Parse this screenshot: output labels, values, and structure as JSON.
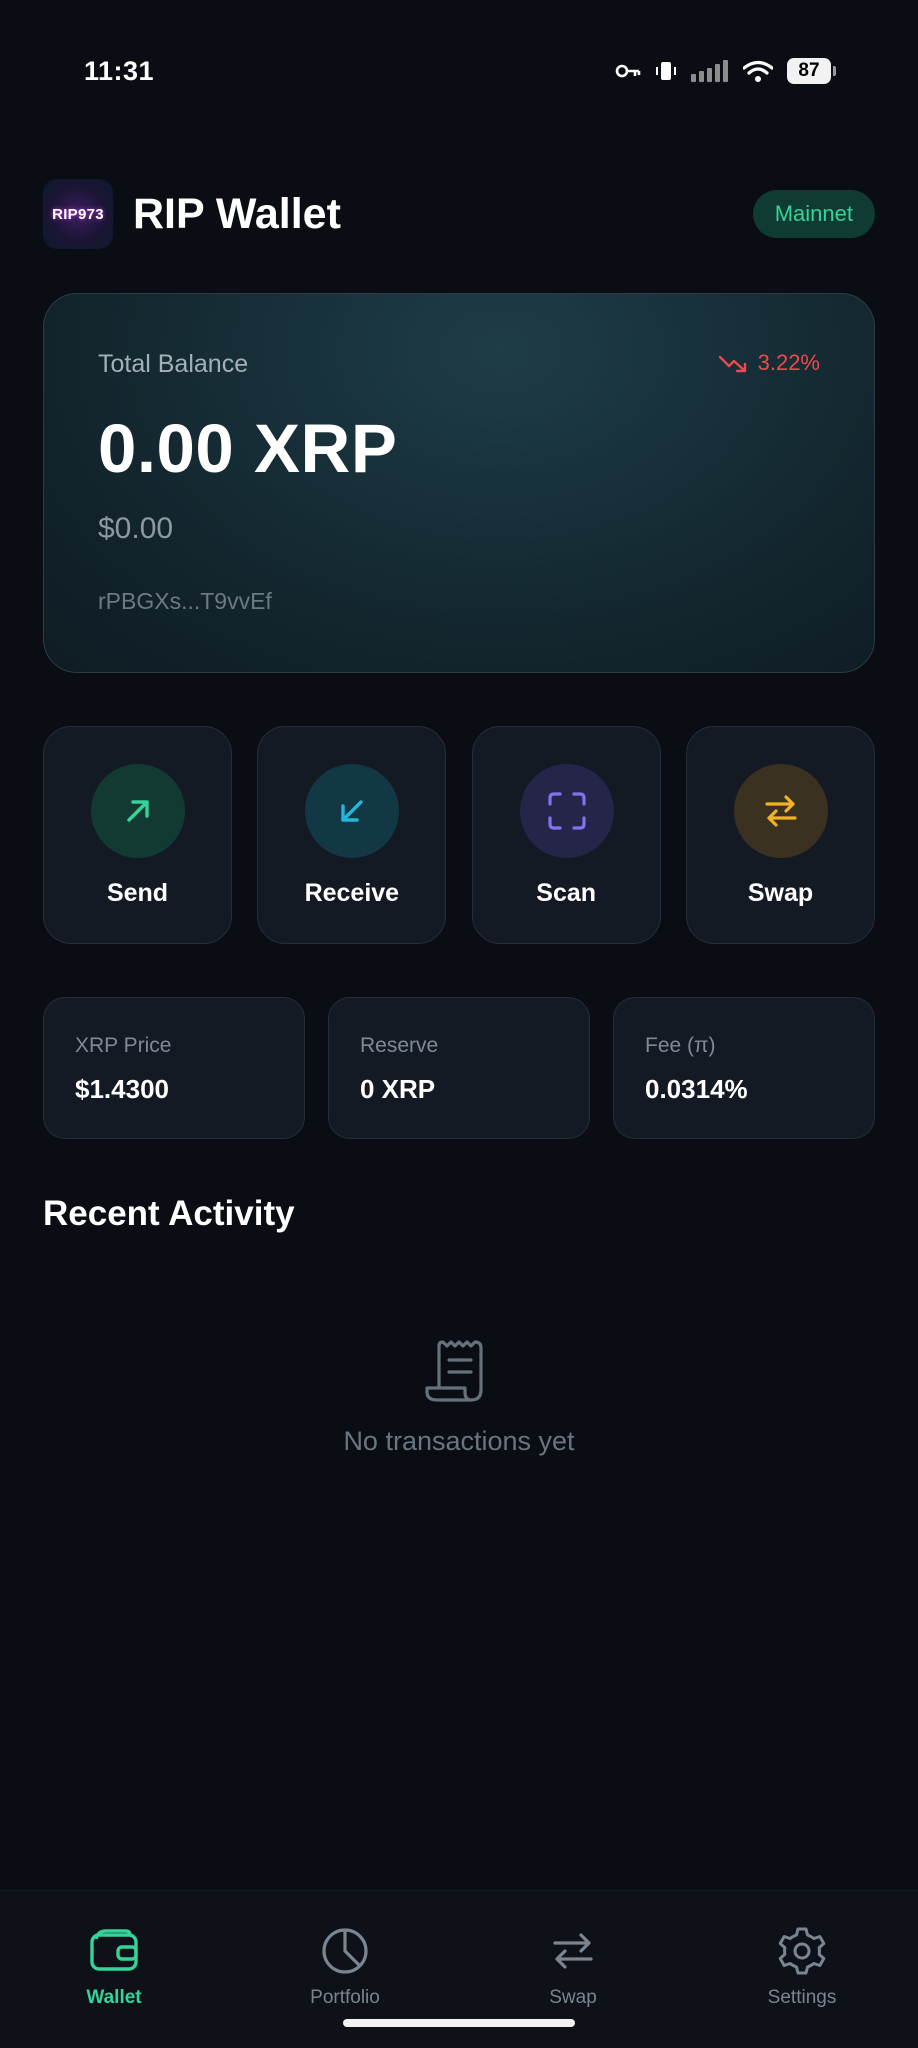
{
  "status_bar": {
    "time": "11:31",
    "battery": "87",
    "icons": [
      "key-icon",
      "vibrate-icon",
      "signal-icon",
      "wifi-icon",
      "battery-icon"
    ]
  },
  "header": {
    "logo_text": "RIP973",
    "title": "RIP Wallet",
    "network": "Mainnet"
  },
  "balance": {
    "label": "Total Balance",
    "change": "3.22%",
    "change_direction": "down",
    "amount": "0.00 XRP",
    "fiat": "$0.00",
    "address": "rPBGXs...T9vvEf"
  },
  "actions": [
    {
      "label": "Send",
      "icon": "arrow-up-right-icon",
      "color": "#34d39a",
      "bg": "#123a33"
    },
    {
      "label": "Receive",
      "icon": "arrow-down-left-icon",
      "color": "#22b6d8",
      "bg": "#123846"
    },
    {
      "label": "Scan",
      "icon": "scan-icon",
      "color": "#7f73f0",
      "bg": "#25254a"
    },
    {
      "label": "Swap",
      "icon": "swap-icon",
      "color": "#f0b323",
      "bg": "#3b3121"
    }
  ],
  "stats": [
    {
      "label": "XRP Price",
      "value": "$1.4300"
    },
    {
      "label": "Reserve",
      "value": "0 XRP"
    },
    {
      "label": "Fee (π)",
      "value": "0.0314%"
    }
  ],
  "activity": {
    "title": "Recent Activity",
    "empty_text": "No transactions yet"
  },
  "nav": [
    {
      "label": "Wallet",
      "icon": "wallet-icon",
      "active": true
    },
    {
      "label": "Portfolio",
      "icon": "pie-chart-icon",
      "active": false
    },
    {
      "label": "Swap",
      "icon": "swap-icon",
      "active": false
    },
    {
      "label": "Settings",
      "icon": "gear-icon",
      "active": false
    }
  ],
  "colors": {
    "background": "#0a0d13",
    "accent": "#34d39a",
    "negative": "#ef4a4a",
    "card": "#141a23"
  }
}
